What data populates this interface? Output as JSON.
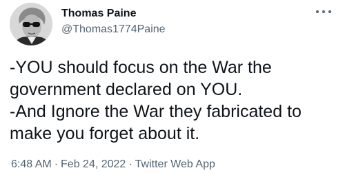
{
  "author": {
    "display_name": "Thomas Paine",
    "handle": "@Thomas1774Paine",
    "avatar_icon": "portrait-with-sunglasses"
  },
  "menu": {
    "icon": "more-dots-icon"
  },
  "tweet": {
    "lines": [
      "-YOU should focus on the War the",
      "government declared on YOU.",
      "-And Ignore the War they fabricated to",
      "make you forget about it."
    ]
  },
  "meta": {
    "time": "6:48 AM",
    "separator": "·",
    "date": "Feb 24, 2022",
    "source": "Twitter Web App"
  },
  "colors": {
    "text": "#0f1419",
    "secondary": "#536471",
    "background": "#ffffff"
  }
}
